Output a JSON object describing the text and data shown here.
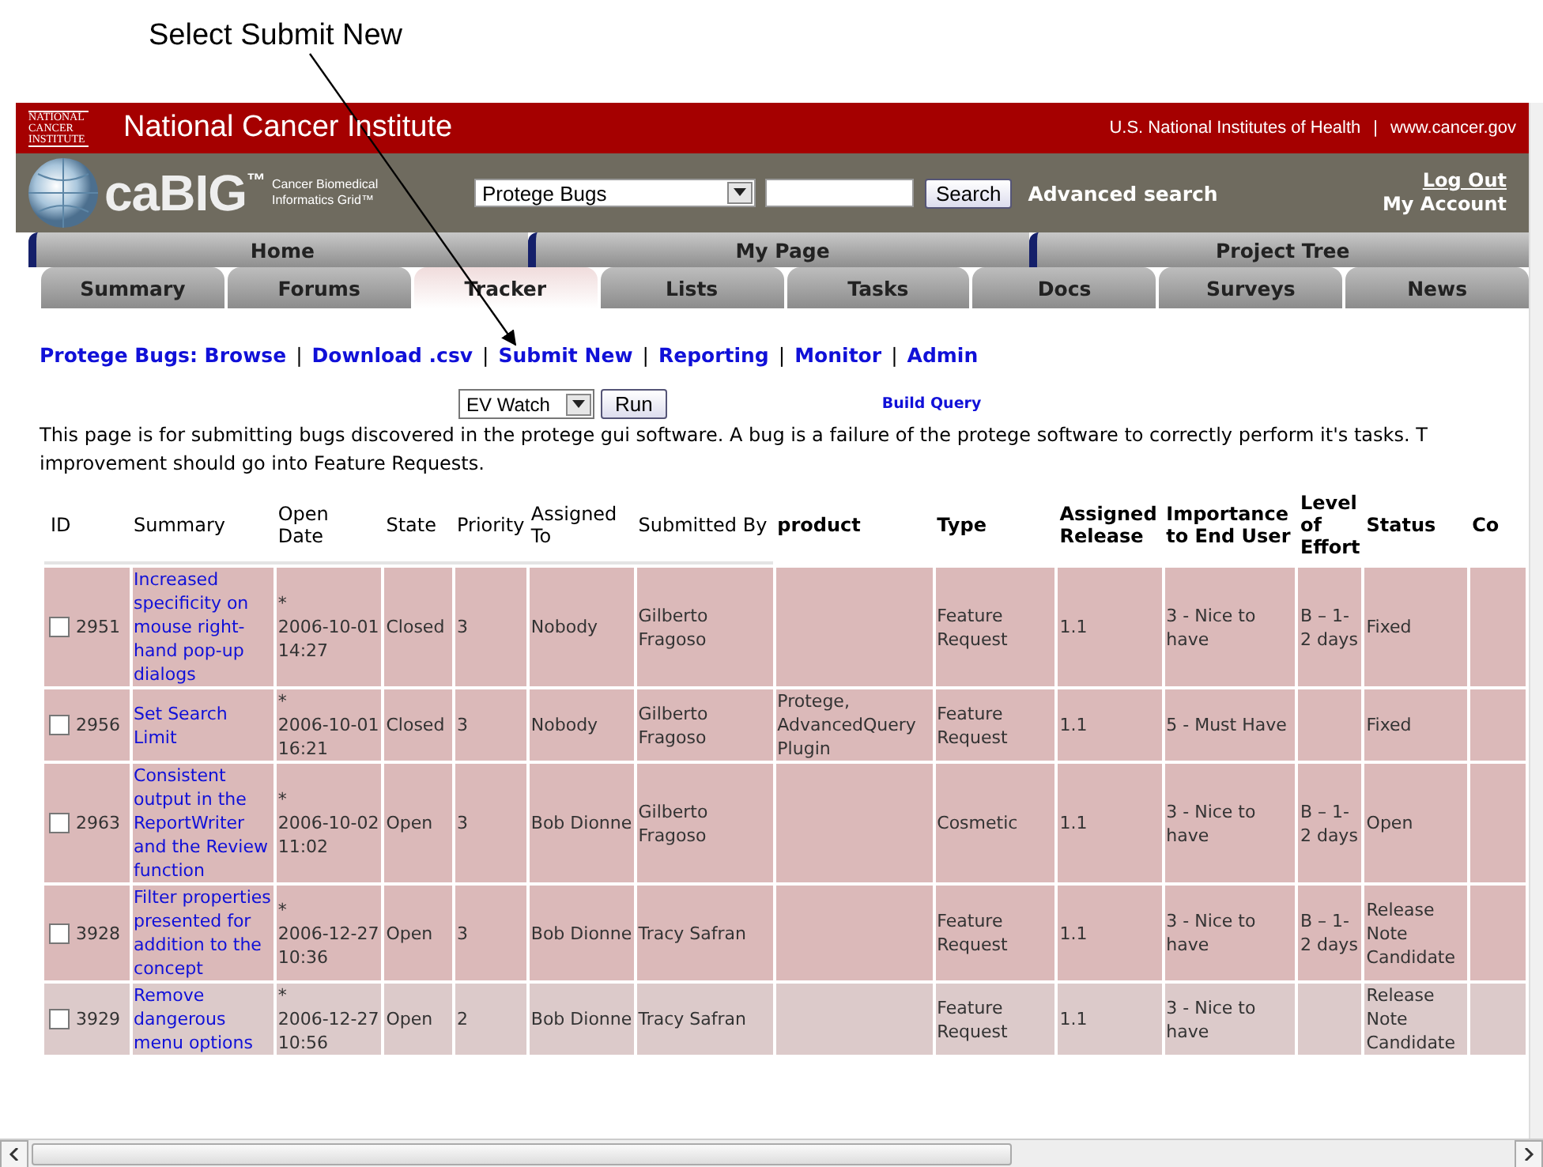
{
  "annotation": {
    "text": "Select Submit New"
  },
  "header": {
    "logo_text": "NATIONAL CANCER INSTITUTE",
    "title": "National Cancer Institute",
    "links": [
      "U.S. National Institutes of Health",
      "www.cancer.gov"
    ],
    "separator": "|"
  },
  "cabig": {
    "brand": "caBIG",
    "trademark": "™",
    "subtitle": [
      "Cancer Biomedical",
      "Informatics Grid™"
    ],
    "project_select": "Protege Bugs",
    "search_button": "Search",
    "advanced_search": "Advanced search",
    "log_out": "Log Out",
    "my_account": "My Account"
  },
  "main_tabs": [
    "Home",
    "My Page",
    "Project Tree"
  ],
  "sub_tabs": [
    {
      "label": "Summary",
      "selected": false
    },
    {
      "label": "Forums",
      "selected": false
    },
    {
      "label": "Tracker",
      "selected": true
    },
    {
      "label": "Lists",
      "selected": false
    },
    {
      "label": "Tasks",
      "selected": false
    },
    {
      "label": "Docs",
      "selected": false
    },
    {
      "label": "Surveys",
      "selected": false
    },
    {
      "label": "News",
      "selected": false
    }
  ],
  "tracker_links": [
    "Protege Bugs: Browse",
    "Download .csv",
    "Submit New",
    "Reporting",
    "Monitor",
    "Admin"
  ],
  "link_separator": "|",
  "query": {
    "select": "EV Watch",
    "run_button": "Run",
    "build_query": "Build Query"
  },
  "description_lines": [
    "This page is for submitting bugs discovered in the protege gui software. A bug is a failure of the protege software to correctly perform it's tasks. T",
    "improvement should go into Feature Requests."
  ],
  "table": {
    "columns": [
      {
        "label": "ID",
        "bold": false
      },
      {
        "label": "Summary",
        "bold": false
      },
      {
        "label": "Open Date",
        "bold": false
      },
      {
        "label": "State",
        "bold": false
      },
      {
        "label": "Priority",
        "bold": false
      },
      {
        "label": "Assigned To",
        "bold": false
      },
      {
        "label": "Submitted By",
        "bold": false
      },
      {
        "label": "product",
        "bold": true
      },
      {
        "label": "Type",
        "bold": true
      },
      {
        "label": "Assigned Release",
        "bold": true
      },
      {
        "label": "Importance to End User",
        "bold": true
      },
      {
        "label": "Level of Effort",
        "bold": true
      },
      {
        "label": "Status",
        "bold": true
      },
      {
        "label": "Co",
        "bold": true
      }
    ],
    "rows": [
      {
        "checked": false,
        "color": "#dbb9b9",
        "id": "2951",
        "summary": "Increased specificity on mouse right-hand pop-up dialogs",
        "flag": "*",
        "open_date": "2006-10-01 14:27",
        "state": "Closed",
        "priority": "3",
        "assigned_to": "Nobody",
        "submitted_by": "Gilberto Fragoso",
        "type": "Feature Request",
        "assigned_release": "1.1",
        "importance": "3 - Nice to have",
        "effort": "B – 1-2 days",
        "status": "Fixed"
      },
      {
        "checked": false,
        "color": "#dbb9b9",
        "id": "2956",
        "summary": "Set Search Limit",
        "flag": "*",
        "open_date": "2006-10-01 16:21",
        "state": "Closed",
        "priority": "3",
        "assigned_to": "Nobody",
        "submitted_by": "Gilberto Fragoso",
        "product": "Protege, AdvancedQuery Plugin",
        "type": "Feature Request",
        "assigned_release": "1.1",
        "importance": "5 - Must Have",
        "status": "Fixed"
      },
      {
        "checked": false,
        "color": "#dbb9b9",
        "id": "2963",
        "summary": "Consistent output in the ReportWriter and the Review function",
        "flag": "*",
        "open_date": "2006-10-02 11:02",
        "state": "Open",
        "priority": "3",
        "assigned_to": "Bob Dionne",
        "submitted_by": "Gilberto Fragoso",
        "type": "Cosmetic",
        "assigned_release": "1.1",
        "importance": "3 - Nice to have",
        "effort": "B – 1-2 days",
        "status": "Open"
      },
      {
        "checked": false,
        "color": "#dbb9b9",
        "id": "3928",
        "summary": "Filter properties presented for addition to the concept",
        "flag": "*",
        "open_date": "2006-12-27 10:36",
        "state": "Open",
        "priority": "3",
        "assigned_to": "Bob Dionne",
        "submitted_by": "Tracy Safran",
        "type": "Feature Request",
        "assigned_release": "1.1",
        "importance": "3 - Nice to have",
        "effort": "B – 1-2 days",
        "status": "Release Note Candidate"
      },
      {
        "checked": false,
        "color": "#dccaca",
        "id": "3929",
        "summary": "Remove dangerous menu options",
        "flag": "*",
        "open_date": "2006-12-27 10:56",
        "state": "Open",
        "priority": "2",
        "assigned_to": "Bob Dionne",
        "submitted_by": "Tracy Safran",
        "type": "Feature Request",
        "assigned_release": "1.1",
        "importance": "3 - Nice to have",
        "status": "Release Note Candidate"
      }
    ]
  }
}
